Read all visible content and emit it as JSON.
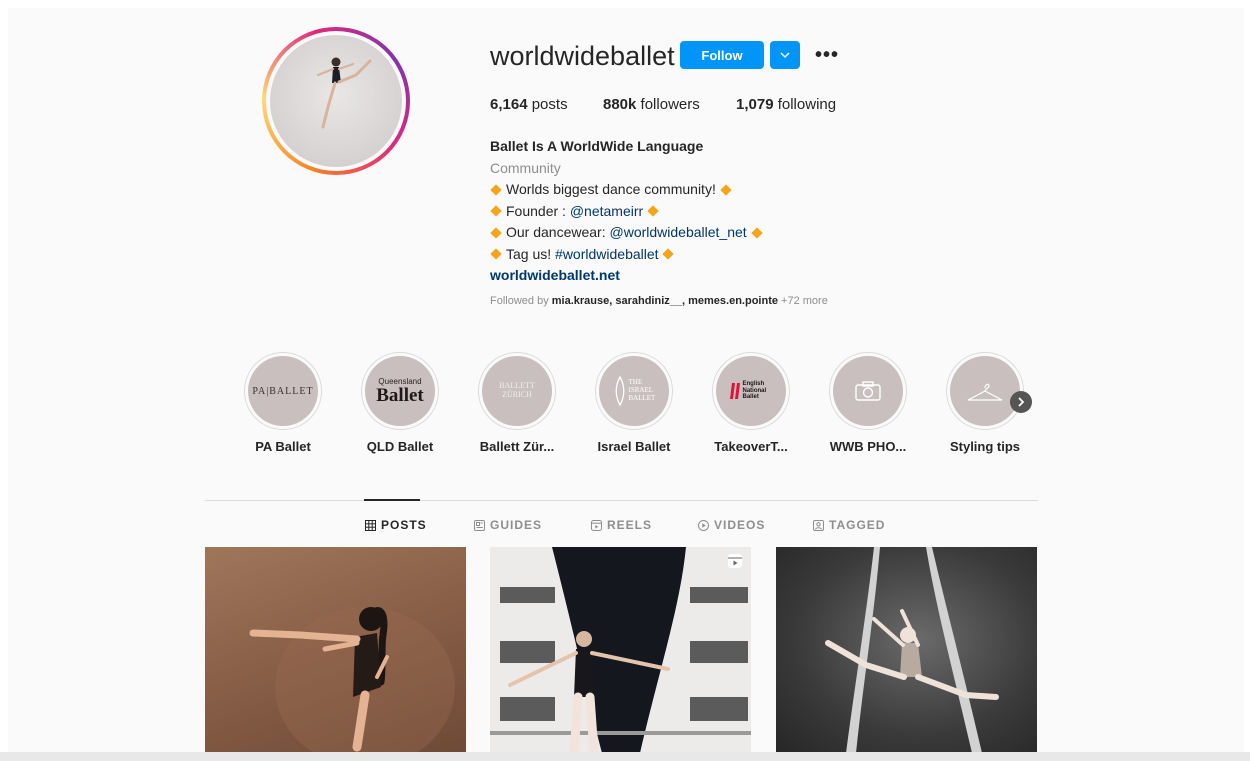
{
  "profile": {
    "username": "worldwideballet",
    "follow_label": "Follow",
    "more_label": "•••",
    "posts_count": "6,164",
    "posts_label": "posts",
    "followers_count": "880k",
    "followers_label": "followers",
    "following_count": "1,079",
    "following_label": "following"
  },
  "bio": {
    "name": "Ballet Is A WorldWide Language",
    "category": "Community",
    "line1": "Worlds biggest dance community!",
    "line2_prefix": "Founder : ",
    "line2_link": "@netameirr",
    "line3_prefix": "Our dancewear: ",
    "line3_link": "@worldwideballet_net",
    "line4_prefix": "Tag us! ",
    "line4_link": "#worldwideballet",
    "website": "worldwideballet.net"
  },
  "followed_by": {
    "prefix": "Followed by ",
    "users": "mia.krause, sarahdiniz__, memes.en.pointe",
    "more": " +72 more"
  },
  "highlights": [
    {
      "label": "PA Ballet",
      "cover_text": "PA|BALLET"
    },
    {
      "label": "QLD Ballet",
      "cover_text_small": "Queensland",
      "cover_text": "Ballet"
    },
    {
      "label": "Ballett Zür...",
      "cover_text": "BALLETT ZÜRICH"
    },
    {
      "label": "Israel Ballet",
      "cover_text": "THE ISRAEL BALLET"
    },
    {
      "label": "TakeoverT...",
      "cover_text": "English National Ballet"
    },
    {
      "label": "WWB PHO...",
      "icon": "camera-icon"
    },
    {
      "label": "Styling tips",
      "icon": "hanger-icon"
    }
  ],
  "tabs": [
    {
      "label": "POSTS",
      "icon": "grid-icon",
      "active": true
    },
    {
      "label": "GUIDES",
      "icon": "guide-icon",
      "active": false
    },
    {
      "label": "REELS",
      "icon": "reels-icon",
      "active": false
    },
    {
      "label": "VIDEOS",
      "icon": "video-icon",
      "active": false
    },
    {
      "label": "TAGGED",
      "icon": "tagged-icon",
      "active": false
    }
  ],
  "colors": {
    "accent": "#0095f6",
    "link": "#00376b",
    "muted": "#8e8e8e",
    "highlight_bg": "#c9bfbf",
    "diamond": "#f7a418"
  }
}
